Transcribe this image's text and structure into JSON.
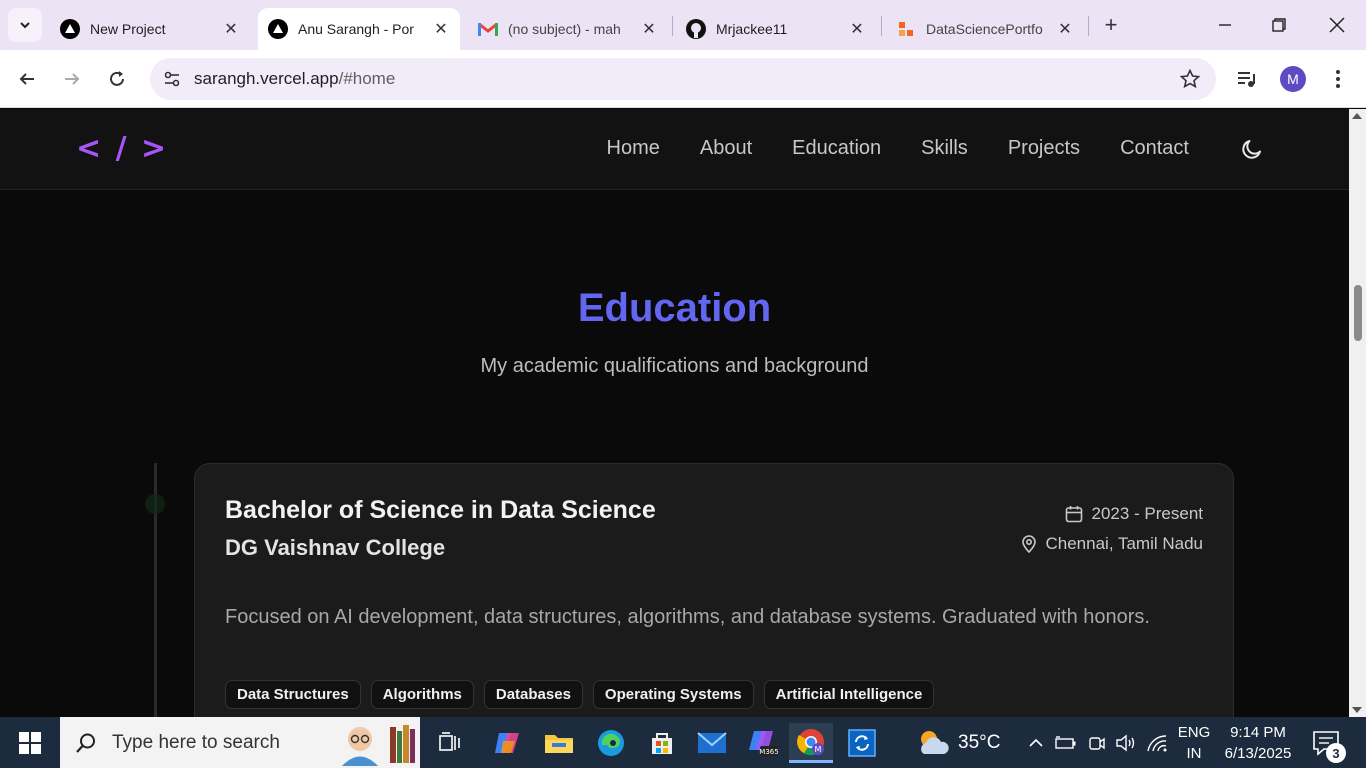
{
  "browser": {
    "tabs": [
      {
        "title": "New Project",
        "active": false
      },
      {
        "title": "Anu Sarangh - Por",
        "active": true
      },
      {
        "title": "(no subject) - mah",
        "active": false
      },
      {
        "title": "Mrjackee11",
        "active": false
      },
      {
        "title": "DataSciencePortfo",
        "active": false
      }
    ],
    "url_host": "sarangh.vercel.app",
    "url_path": "/#home",
    "profile_initial": "M"
  },
  "site": {
    "logo": "< / >",
    "nav": [
      "Home",
      "About",
      "Education",
      "Skills",
      "Projects",
      "Contact"
    ]
  },
  "education": {
    "title": "Education",
    "subtitle": "My academic qualifications and background",
    "entries": [
      {
        "degree": "Bachelor of Science in Data Science",
        "institution": "DG Vaishnav College",
        "period": "2023 - Present",
        "location": "Chennai, Tamil Nadu",
        "description": "Focused on AI development, data structures, algorithms, and database systems. Graduated with honors.",
        "tags": [
          "Data Structures",
          "Algorithms",
          "Databases",
          "Operating Systems",
          "Artificial Intelligence"
        ]
      }
    ]
  },
  "taskbar": {
    "search_placeholder": "Type here to search",
    "weather": "35°C",
    "lang_line1": "ENG",
    "lang_line2": "IN",
    "time": "9:14 PM",
    "date": "6/13/2025",
    "notification_count": "3"
  },
  "colors": {
    "accent_purple": "#a855f7",
    "title_indigo": "#6366f1",
    "page_bg": "#0a0a0a"
  }
}
